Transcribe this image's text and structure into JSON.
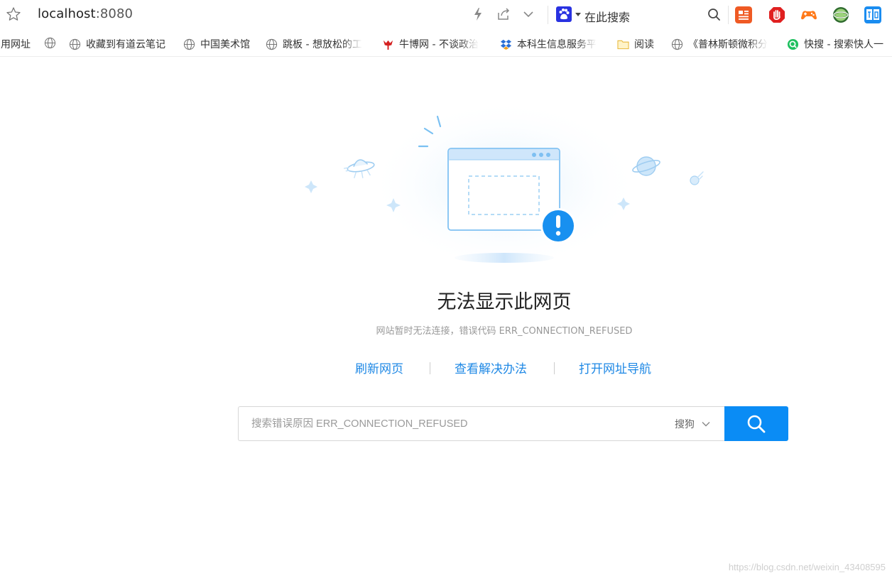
{
  "addressbar": {
    "url_host": "localhost",
    "url_port": ":8080",
    "search_engine_label": "在此搜索"
  },
  "bookmarks": [
    {
      "label": "用网址",
      "icon": "none"
    },
    {
      "label": "",
      "icon": "globe-icon"
    },
    {
      "label": "收藏到有道云笔记",
      "icon": "globe-icon"
    },
    {
      "label": "中国美术馆",
      "icon": "globe-icon"
    },
    {
      "label": "跳板 - 想放松的工",
      "icon": "globe-icon"
    },
    {
      "label": "牛博网 - 不谈政治",
      "icon": "niubo-icon"
    },
    {
      "label": "本科生信息服务平",
      "icon": "dropbox-icon"
    },
    {
      "label": "阅读",
      "icon": "folder-icon"
    },
    {
      "label": "《普林斯顿微积分",
      "icon": "globe-icon"
    },
    {
      "label": "快搜 - 搜索快人一",
      "icon": "kuaisou-icon"
    }
  ],
  "error": {
    "title": "无法显示此网页",
    "subtitle": "网站暂时无法连接，错误代码 ERR_CONNECTION_REFUSED",
    "links": [
      "刷新网页",
      "查看解决办法",
      "打开网址导航"
    ],
    "search_placeholder": "搜索错误原因 ERR_CONNECTION_REFUSED",
    "search_engine": "搜狗"
  },
  "watermark": "https://blog.csdn.net/weixin_43408595",
  "colors": {
    "accent": "#1e88e5",
    "button": "#0a8cf5",
    "illustration": "#8cc8f5"
  }
}
